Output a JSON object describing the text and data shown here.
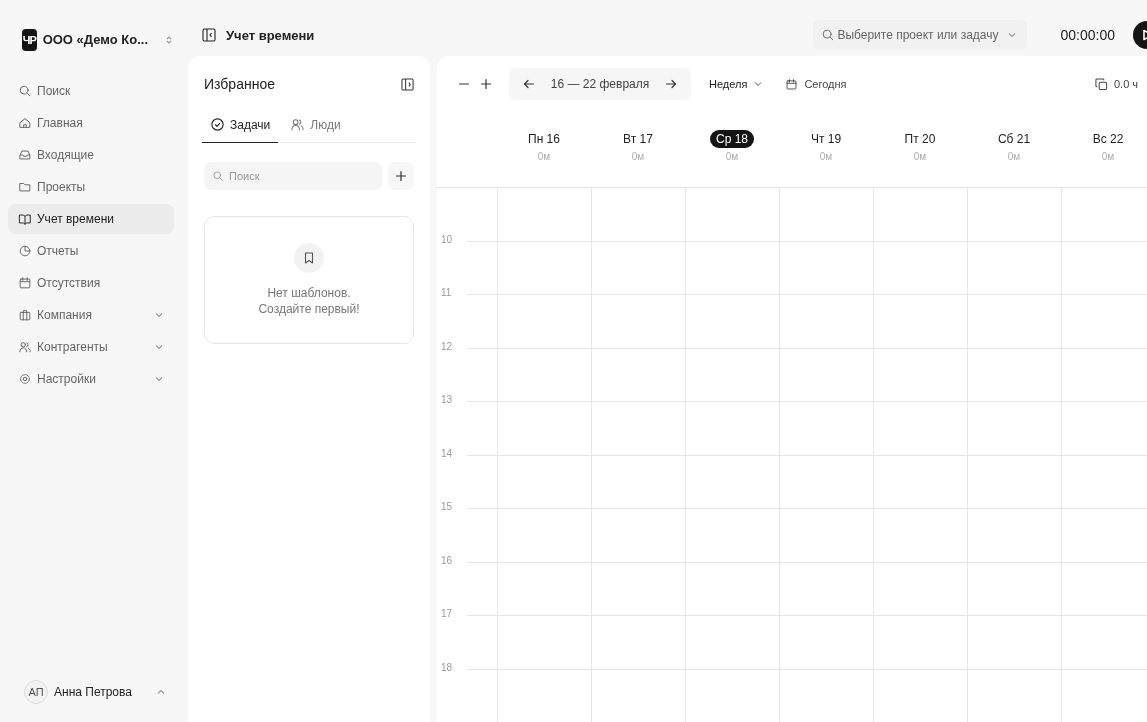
{
  "workspace": {
    "logo": "ЧР",
    "name": "ООО «Демо Ко..."
  },
  "sidebar": {
    "items": [
      {
        "label": "Поиск",
        "selected": false,
        "expandable": false
      },
      {
        "label": "Главная",
        "selected": false,
        "expandable": false
      },
      {
        "label": "Входящие",
        "selected": false,
        "expandable": false
      },
      {
        "label": "Проекты",
        "selected": false,
        "expandable": false
      },
      {
        "label": "Учет времени",
        "selected": true,
        "expandable": false
      },
      {
        "label": "Отчеты",
        "selected": false,
        "expandable": false
      },
      {
        "label": "Отсутствия",
        "selected": false,
        "expandable": false
      },
      {
        "label": "Компания",
        "selected": false,
        "expandable": true
      },
      {
        "label": "Контрагенты",
        "selected": false,
        "expandable": true
      },
      {
        "label": "Настройки",
        "selected": false,
        "expandable": true
      }
    ],
    "user": {
      "initials": "АП",
      "name": "Анна Петрова"
    }
  },
  "header": {
    "title": "Учет времени",
    "project_picker": {
      "placeholder": "Выберите проект или задачу"
    },
    "timer": "00:00:00"
  },
  "favorites": {
    "title": "Избранное",
    "tabs": [
      {
        "label": "Задачи",
        "selected": true
      },
      {
        "label": "Люди",
        "selected": false
      }
    ],
    "search": {
      "placeholder": "Поиск"
    },
    "empty": [
      "Нет шаблонов.",
      "Создайте первый!"
    ]
  },
  "calendar": {
    "range": "16 — 22 февраля",
    "view": "Неделя",
    "today": "Сегодня",
    "total": "0.0 ч",
    "days": [
      {
        "label": "Пн 16",
        "total": "0м",
        "selected": false
      },
      {
        "label": "Вт 17",
        "total": "0м",
        "selected": false
      },
      {
        "label": "Ср 18",
        "total": "0м",
        "selected": true
      },
      {
        "label": "Чт 19",
        "total": "0м",
        "selected": false
      },
      {
        "label": "Пт 20",
        "total": "0м",
        "selected": false
      },
      {
        "label": "Сб 21",
        "total": "0м",
        "selected": false
      },
      {
        "label": "Вс 22",
        "total": "0м",
        "selected": false
      }
    ],
    "hours": [
      "10",
      "11",
      "12",
      "13",
      "14",
      "15",
      "16",
      "17",
      "18"
    ]
  }
}
